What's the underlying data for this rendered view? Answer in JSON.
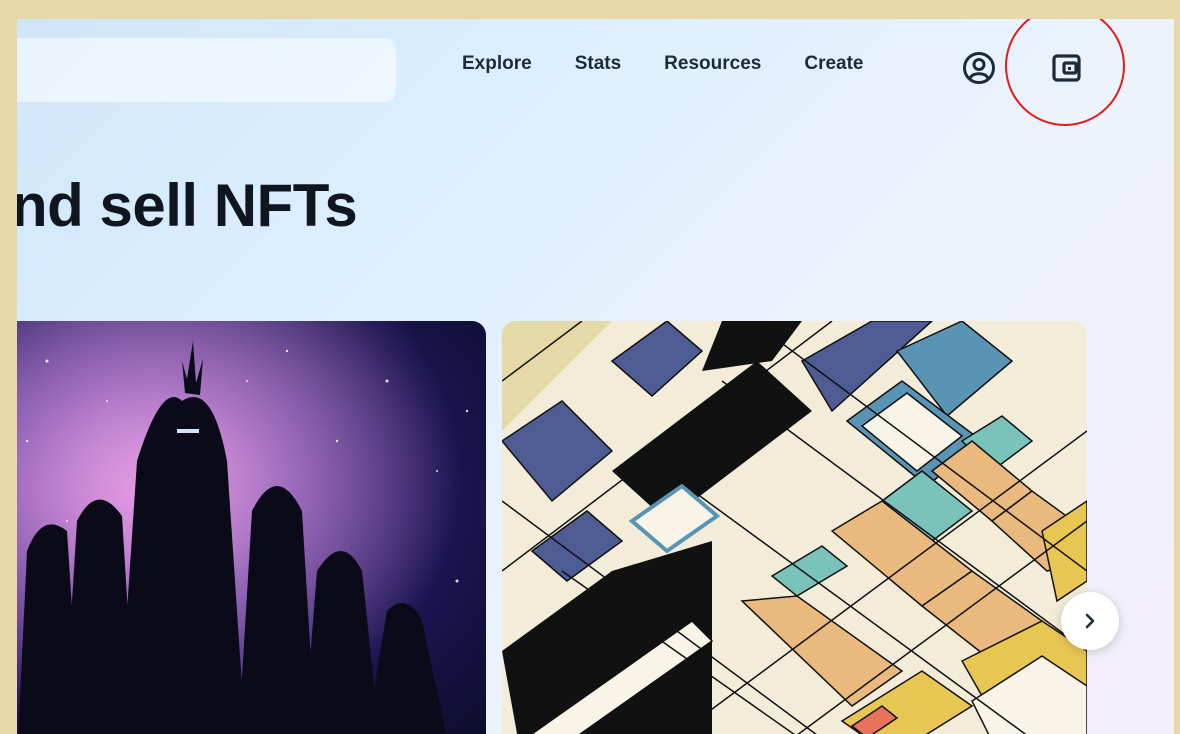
{
  "search": {
    "placeholder": ""
  },
  "nav": {
    "links": [
      "Explore",
      "Stats",
      "Resources",
      "Create"
    ],
    "icons": [
      "account-icon",
      "wallet-icon"
    ]
  },
  "hero": {
    "title": "nd sell NFTs"
  },
  "carousel": {
    "next_icon": "chevron-right-icon"
  },
  "colors": {
    "frame": "#e8d8a8",
    "text": "#1c2a3a",
    "heading": "#0f1620",
    "highlight": "#e21b1b"
  }
}
